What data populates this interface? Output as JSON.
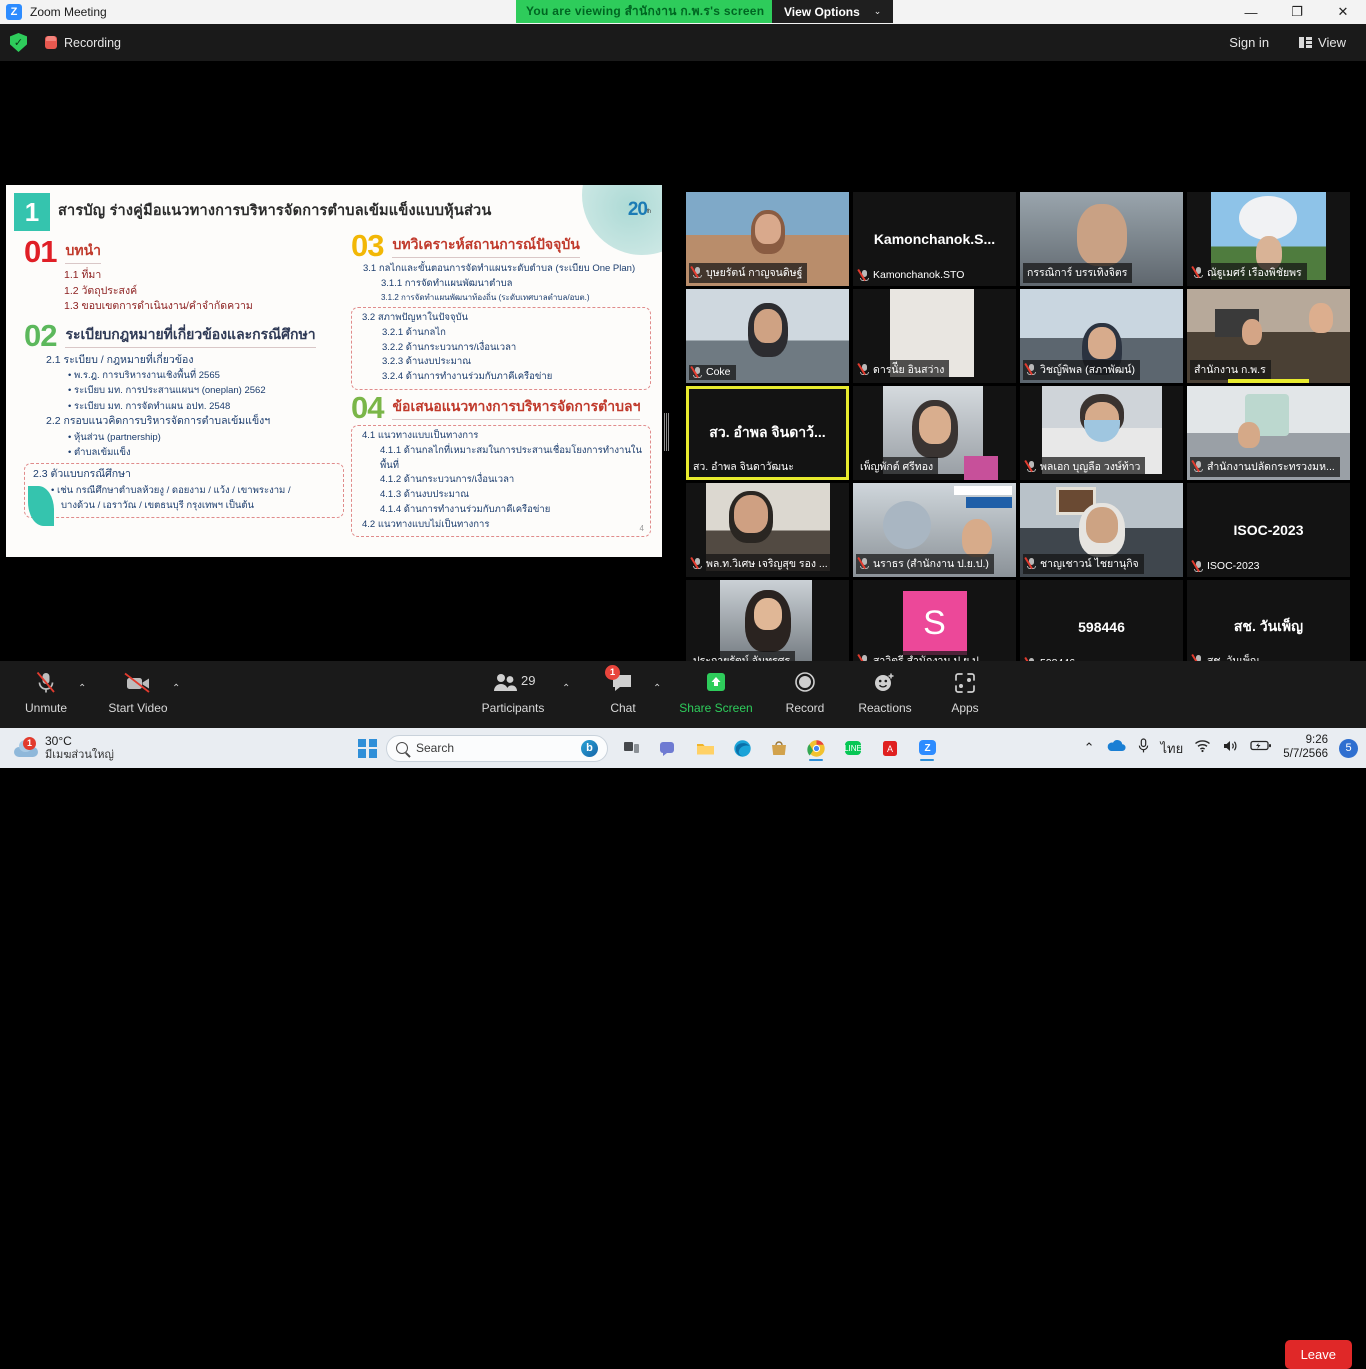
{
  "window": {
    "app_icon": "zoom-icon",
    "title": "Zoom Meeting",
    "share_banner": "You are viewing สำนักงาน ก.พ.ร's screen",
    "view_options": "View Options",
    "view_options_chevron": "⌄",
    "minimize": "—",
    "restore": "❐",
    "close": "✕"
  },
  "header": {
    "encryption_icon": "shield-check-icon",
    "encryption_glyph": "✓",
    "recording_icon": "recording-icon",
    "recording_label": "Recording",
    "sign_in": "Sign in",
    "view_label": "View"
  },
  "slide": {
    "number_badge": "1",
    "title": "สารบัญ ร่างคู่มือแนวทางการบริหารจัดการตำบลเข้มแข็งแบบหุ้นส่วน",
    "logo": "20",
    "logo_sub": "YEARS\nก.พ.ร.",
    "page_number": "4",
    "sections": [
      {
        "num": "01",
        "heading": "บทนำ",
        "items": [
          "1.1 ที่มา",
          "1.2 วัตถุประสงค์",
          "1.3 ขอบเขตการดำเนินงาน/คำจำกัดความ"
        ]
      },
      {
        "num": "02",
        "heading": "ระเบียบกฎหมายที่เกี่ยวข้องและกรณีศึกษา",
        "items": [
          "2.1 ระเบียบ / กฎหมายที่เกี่ยวข้อง",
          "พ.ร.ฎ. การบริหารงานเชิงพื้นที่ 2565",
          "ระเบียบ มท. การประสานแผนฯ (oneplan) 2562",
          "ระเบียบ มท. การจัดทำแผน อปท. 2548",
          "2.2 กรอบแนวคิดการบริหารจัดการตำบลเข้มแข็งฯ",
          "หุ้นส่วน (partnership)",
          "ตำบลเข้มแข็ง",
          "2.3 ตัวแบบกรณีศึกษา",
          "เช่น กรณีศึกษาตำบลห้วยงู / ดอยงาม / แว้ง / เขาพระงาม /",
          "บางด้วน / เอราวัณ / เขตธนบุรี กรุงเทพฯ เป็นต้น"
        ]
      },
      {
        "num": "03",
        "heading": "บทวิเคราะห์สถานการณ์ปัจจุบัน",
        "items": [
          "3.1 กลไกและขั้นตอนการจัดทำแผนระดับตำบล (ระเบียบ One Plan)",
          "3.1.1 การจัดทำแผนพัฒนาตำบล",
          "3.1.2 การจัดทำแผนพัฒนาท้องถิ่น (ระดับเทศบาลตำบล/อบต.)",
          "3.2 สภาพปัญหาในปัจจุบัน",
          "3.2.1 ด้านกลไก",
          "3.2.2 ด้านกระบวนการ/เงื่อนเวลา",
          "3.2.3 ด้านงบประมาณ",
          "3.2.4 ด้านการทำงานร่วมกับภาคีเครือข่าย"
        ]
      },
      {
        "num": "04",
        "heading": "ข้อเสนอแนวทางการบริหารจัดการตำบลฯ",
        "items": [
          "4.1 แนวทางแบบเป็นทางการ",
          "4.1.1 ด้านกลไกที่เหมาะสมในการประสานเชื่อมโยงการทำงานในพื้นที่",
          "4.1.2 ด้านกระบวนการ/เงื่อนเวลา",
          "4.1.3 ด้านงบประมาณ",
          "4.1.4 ด้านการทำงานร่วมกับภาคีเครือข่าย",
          "4.2 แนวทางแบบไม่เป็นทางการ"
        ]
      }
    ]
  },
  "participants": [
    {
      "name": "บุษยรัตน์ กาญจนดิษฐ์",
      "muted": true,
      "video": true,
      "bg": "bg1"
    },
    {
      "name": "Kamonchanok.STO",
      "center": "Kamonchanok.S...",
      "muted": true,
      "video": false
    },
    {
      "name": "กรรณิการ์ บรรเทิงจิตร",
      "muted": false,
      "video": true,
      "bg": "bg2"
    },
    {
      "name": "ณัฐูเมศร์ เรืองพิชัยพร",
      "muted": true,
      "video": true,
      "bg": "bg4"
    },
    {
      "name": "Coke",
      "muted": true,
      "video": true,
      "bg": "bg3"
    },
    {
      "name": "ดารนัีย อินสว่าง",
      "muted": true,
      "video": true,
      "bg": "bg6"
    },
    {
      "name": "วิชญ์พิพล (สภาพัฒน์)",
      "muted": true,
      "video": true,
      "bg": "bg7"
    },
    {
      "name": "สำนักงาน ก.พ.ร",
      "muted": false,
      "video": true,
      "bg": "bg8",
      "active_audio": true
    },
    {
      "name": "สว. อำพล จินดาวัฒนะ",
      "center": "สว. อำพล จินดาว้...",
      "muted": false,
      "video": false,
      "speaking": true
    },
    {
      "name": "เพ็ญพักต์ ศรีทอง",
      "muted": false,
      "video": true,
      "bg": "bg9"
    },
    {
      "name": "พลเอก บุญลือ วงษ์ท้าว",
      "muted": true,
      "video": true,
      "bg": "bg10"
    },
    {
      "name": "สำนักงานปลัดกระทรวงมห...",
      "muted": true,
      "video": true,
      "bg": "bg11"
    },
    {
      "name": "พล.ท.วิเศษ เจริญสุข รอง ...",
      "muted": true,
      "video": true,
      "bg": "bg12"
    },
    {
      "name": "นราธร (สำนักงาน ป.ย.ป.)",
      "muted": true,
      "video": true,
      "bg": "bg13"
    },
    {
      "name": "ชาญเชาวน์ ไชยานุกิจ",
      "muted": true,
      "video": true,
      "bg": "bg14"
    },
    {
      "name": "ISOC-2023",
      "center": "ISOC-2023",
      "muted": true,
      "video": false
    },
    {
      "name": "ประกายรัตน์ จันทรศร",
      "muted": false,
      "video": true,
      "bg": "bg15"
    },
    {
      "name": "สาวิตรี สำนักงาน ป.ย.ป",
      "muted": true,
      "video": false,
      "avatar": "S",
      "avatar_color": "#ec4899"
    },
    {
      "name": "598446",
      "center": "598446",
      "muted": true,
      "video": false
    },
    {
      "name": "สช. วันเพ็ญ",
      "center": "สช. วันเพ็ญ",
      "muted": true,
      "video": false
    }
  ],
  "grid": {
    "scroll_down_icon": "chevron-down-icon",
    "scroll_down_glyph": "⌄"
  },
  "toolbar": {
    "mute": {
      "label": "Unmute",
      "icon": "microphone-muted-icon",
      "caret": "⌃"
    },
    "video": {
      "label": "Start Video",
      "icon": "video-off-icon",
      "caret": "⌃"
    },
    "participants": {
      "label": "Participants",
      "icon": "participants-icon",
      "count": "29",
      "caret": "⌃"
    },
    "chat": {
      "label": "Chat",
      "icon": "chat-icon",
      "badge": "1",
      "caret": "⌃"
    },
    "share": {
      "label": "Share Screen",
      "icon": "share-screen-icon"
    },
    "record": {
      "label": "Record",
      "icon": "record-icon"
    },
    "reactions": {
      "label": "Reactions",
      "icon": "reactions-icon"
    },
    "apps": {
      "label": "Apps",
      "icon": "apps-icon"
    },
    "leave": {
      "label": "Leave"
    }
  },
  "taskbar": {
    "weather": {
      "temp": "30°C",
      "condition": "มีเมฆส่วนใหญ่",
      "badge": "1",
      "icon": "cloud-icon"
    },
    "start_icon": "windows-start-icon",
    "search_placeholder": "Search",
    "search_icon": "search-icon",
    "copilot_icon": "copilot-icon",
    "apps": [
      {
        "name": "task-view-icon",
        "glyph": "▥"
      },
      {
        "name": "teams-icon",
        "glyph": "▢"
      },
      {
        "name": "file-explorer-icon",
        "glyph": "🗂"
      },
      {
        "name": "edge-icon",
        "glyph": "◎"
      },
      {
        "name": "store-icon",
        "glyph": "🛍"
      },
      {
        "name": "chrome-icon",
        "glyph": "◍"
      },
      {
        "name": "line-icon",
        "glyph": "L"
      },
      {
        "name": "acrobat-icon",
        "glyph": "A"
      },
      {
        "name": "zoom-icon",
        "glyph": "Z"
      }
    ],
    "tray": {
      "overflow": "⌃",
      "onedrive_icon": "onedrive-icon",
      "mic_icon": "microphone-icon",
      "language": "ไทย",
      "wifi_icon": "wifi-icon",
      "volume_icon": "volume-icon",
      "battery_icon": "battery-charging-icon",
      "time": "9:26",
      "date": "5/7/2566",
      "notification_count": "5"
    }
  }
}
